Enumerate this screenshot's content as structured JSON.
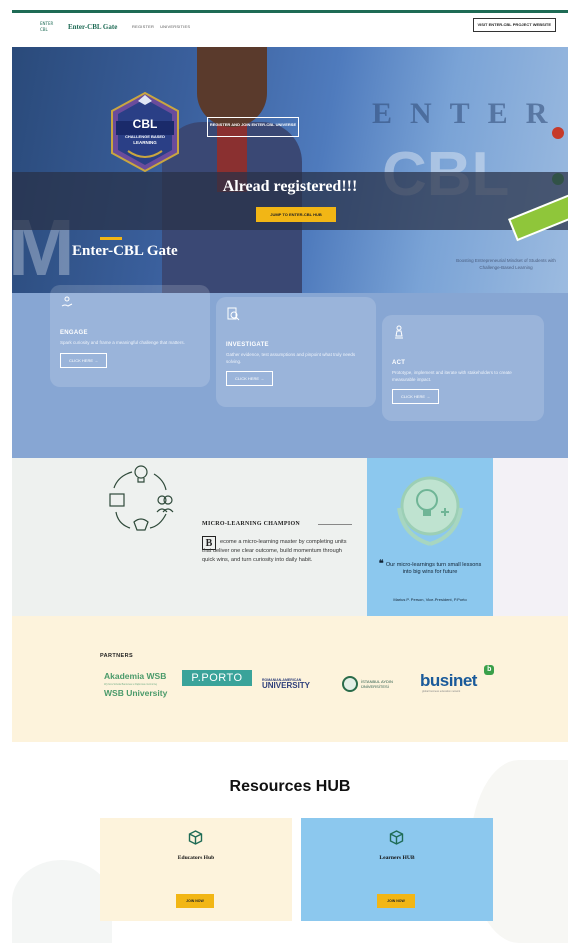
{
  "header": {
    "logo_text": "ENTER CBL",
    "brand": "Enter-CBL Gate",
    "nav": [
      "REGISTER",
      "UNIVERSITIES"
    ],
    "visit_button": "VISIT ENTER-CBL PROJECT WEBSITE"
  },
  "hero": {
    "badge_cbl": "CBL",
    "badge_sub1": "CHALLENGE BASED",
    "badge_sub2": "LEARNING",
    "register_label": "REGISTER AND JOIN ENTER-CBL UNIVERSE",
    "already": "Alread registered!!!",
    "jump_button": "JUMP TO ENTER-CBL HUB",
    "gate_title": "Enter-CBL Gate",
    "bg_word_enter": "ENTER",
    "bg_word_cbl": "CBL",
    "bg_letter": "M",
    "caption": "Boosting Entrepreneurial Mindset of Students with Challenge-Based Learning"
  },
  "steps": [
    {
      "title": "ENGAGE",
      "text": "Spark curiosity and frame a meaningful challenge that matters.",
      "button": "CLICK HERE →"
    },
    {
      "title": "INVESTIGATE",
      "text": "Gather evidence, test assumptions and pinpoint what truly needs solving.",
      "button": "CLICK HERE →"
    },
    {
      "title": "ACT",
      "text": "Prototype, implement and iterate with stakeholders to create measurable impact.",
      "button": "CLICK HERE →"
    }
  ],
  "micro": {
    "title": "MICRO-LEARNING CHAMPION",
    "initial": "B",
    "text": "ecome a micro-learning master by completing units that deliver one clear outcome, build momentum through quick wins, and turn curiosity into daily habit.",
    "quote": "Our micro-learnings turn small lessons into big wins for future",
    "author": "Marius P. Person, Vice-President, P.Porto"
  },
  "partners": {
    "title": "PARTNERS",
    "wsb_1": "Akademia WSB",
    "wsb_small": "Wyższa Szkoła Bankowa w Dąbrowie Górniczej",
    "wsb_2": "WSB University",
    "porto": "P.PORTO",
    "rau_1": "ROMANIAN-AMERICAN",
    "rau_2": "UNIVERSITY",
    "aydin_1": "İSTANBUL AYDIN",
    "aydin_2": "ÜNİVERSİTESİ",
    "businet": "businet",
    "businet_badge": "b",
    "businet_tag": "global business education network"
  },
  "resources": {
    "title": "Resources HUB",
    "hubs": [
      {
        "name": "Educators Hub",
        "button": "JOIN NOW"
      },
      {
        "name": "Learners HUB",
        "button": "JOIN NOW"
      }
    ]
  },
  "colors": {
    "brand_green": "#1e6b55",
    "accent_yellow": "#f2b615",
    "steps_blue": "#87a6d3",
    "light_blue": "#8cc8ee",
    "cream": "#fdf3dc"
  }
}
